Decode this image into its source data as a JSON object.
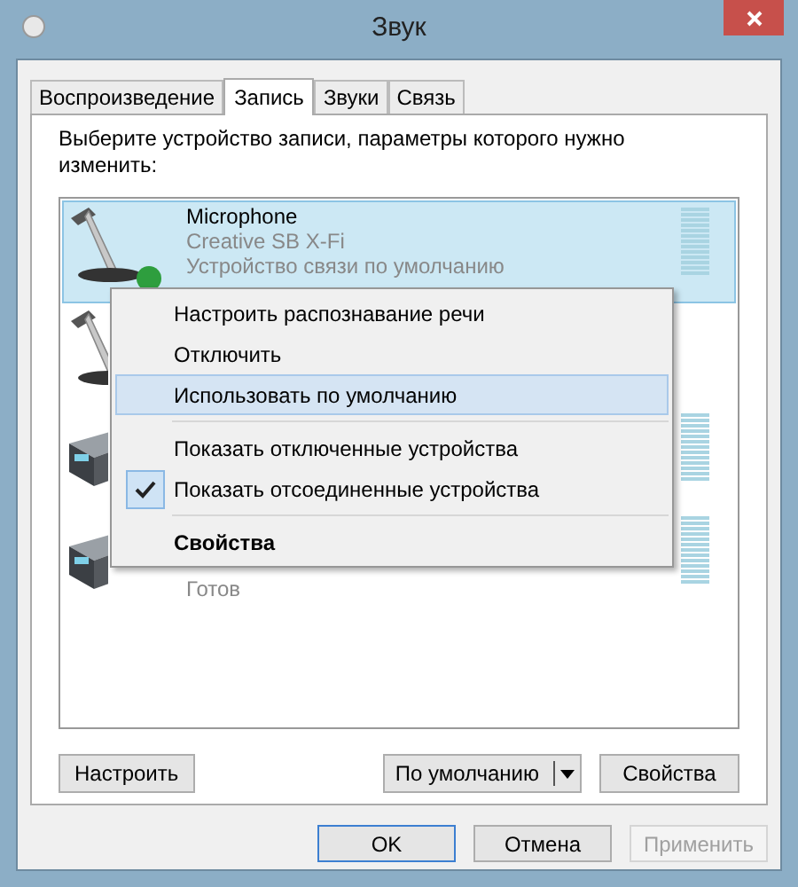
{
  "window": {
    "title": "Звук"
  },
  "tabs": [
    {
      "label": "Воспроизведение",
      "selected": false
    },
    {
      "label": "Запись",
      "selected": true
    },
    {
      "label": "Звуки",
      "selected": false
    },
    {
      "label": "Связь",
      "selected": false
    }
  ],
  "instruction": "Выберите устройство записи, параметры которого нужно изменить:",
  "devices": [
    {
      "kind": "microphone",
      "name": "Microphone",
      "driver": "Creative SB X-Fi",
      "status": "Устройство связи по умолчанию",
      "selected": true,
      "default_comm": true,
      "meter": true
    },
    {
      "kind": "microphone",
      "selected": false,
      "default_comm": false,
      "meter": false
    },
    {
      "kind": "line-in",
      "selected": false,
      "default_comm": false,
      "meter": true
    },
    {
      "kind": "line-in",
      "status": "Готов",
      "selected": false,
      "default_comm": false,
      "meter": true
    }
  ],
  "context_menu": [
    {
      "kind": "item",
      "label": "Настроить распознавание речи",
      "selected": false,
      "checked": false,
      "bold": false
    },
    {
      "kind": "item",
      "label": "Отключить",
      "selected": false,
      "checked": false,
      "bold": false
    },
    {
      "kind": "item",
      "label": "Использовать по умолчанию",
      "selected": true,
      "checked": false,
      "bold": false
    },
    {
      "kind": "separator"
    },
    {
      "kind": "item",
      "label": "Показать отключенные устройства",
      "selected": false,
      "checked": false,
      "bold": false
    },
    {
      "kind": "item",
      "label": "Показать отсоединенные устройства",
      "selected": false,
      "checked": true,
      "bold": false
    },
    {
      "kind": "separator"
    },
    {
      "kind": "item",
      "label": "Свойства",
      "selected": false,
      "checked": false,
      "bold": true
    }
  ],
  "panel_buttons": {
    "configure": "Настроить",
    "set_default": "По умолчанию",
    "properties": "Свойства"
  },
  "dialog_buttons": [
    {
      "label": "OK",
      "default": true,
      "disabled": false
    },
    {
      "label": "Отмена",
      "default": false,
      "disabled": false
    },
    {
      "label": "Применить",
      "default": false,
      "disabled": true
    }
  ]
}
